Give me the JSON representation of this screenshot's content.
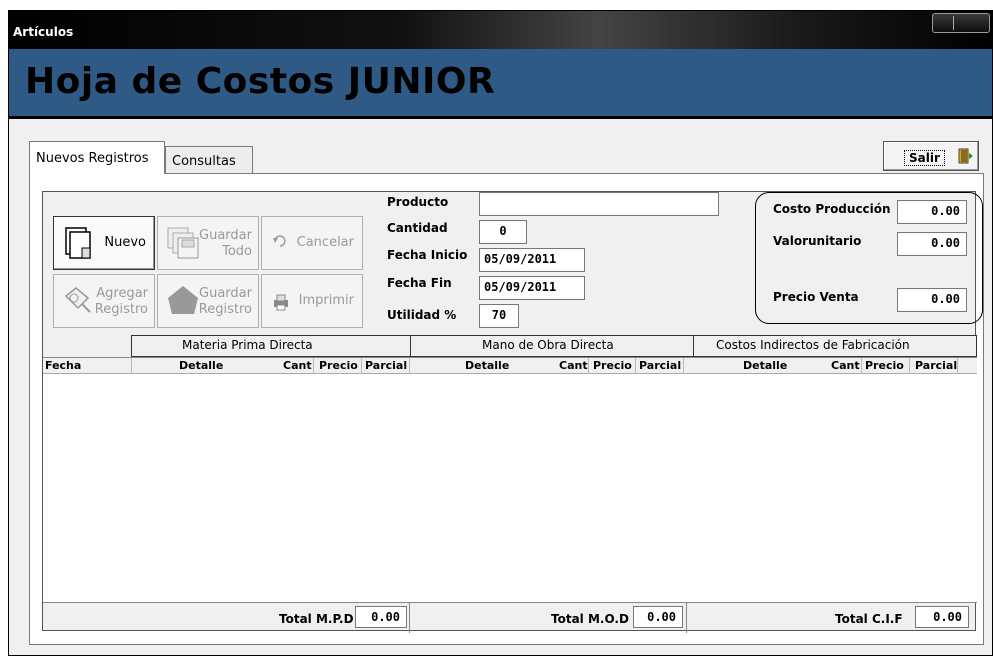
{
  "window": {
    "title": "Artículos"
  },
  "header": {
    "title": "Hoja de Costos  JUNIOR"
  },
  "tabs": [
    {
      "label": "Nuevos Registros",
      "active": true
    },
    {
      "label": "Consultas",
      "active": false
    }
  ],
  "exit_button": {
    "label": "Salir",
    "icon": "exit-door-icon"
  },
  "toolbar": {
    "nuevo": {
      "label": "Nuevo",
      "enabled": true,
      "icon": "new-document-icon"
    },
    "guardar_todo": {
      "label_line1": "Guardar",
      "label_line2": "Todo",
      "enabled": false,
      "icon": "save-all-icon"
    },
    "cancelar": {
      "label": "Cancelar",
      "enabled": false,
      "icon": "undo-icon"
    },
    "agregar_registro": {
      "label_line1": "Agregar",
      "label_line2": "Registro",
      "enabled": false,
      "icon": "add-record-icon"
    },
    "guardar_registro": {
      "label_line1": "Guardar",
      "label_line2": "Registro",
      "enabled": false,
      "icon": "save-record-icon"
    },
    "imprimir": {
      "label": "Imprimir",
      "enabled": false,
      "icon": "printer-icon"
    }
  },
  "form": {
    "producto_label": "Producto",
    "producto_value": "",
    "cantidad_label": "Cantidad",
    "cantidad_value": "0",
    "fecha_inicio_label": "Fecha Inicio",
    "fecha_inicio_value": "05/09/2011",
    "fecha_fin_label": "Fecha Fin",
    "fecha_fin_value": "05/09/2011",
    "utilidad_label": "Utilidad %",
    "utilidad_value": "70"
  },
  "costs": {
    "costo_produccion_label": "Costo Producción",
    "costo_produccion_value": "0.00",
    "valor_unitario_label": "Valorunitario",
    "valor_unitario_value": "0.00",
    "precio_venta_label": "Precio Venta",
    "precio_venta_value": "0.00"
  },
  "grid": {
    "groups": [
      "Materia Prima Directa",
      "Mano de Obra Directa",
      "Costos Indirectos de Fabricación"
    ],
    "columns": {
      "fecha": "Fecha",
      "mpd": [
        "Detalle",
        "Cant",
        "Precio",
        "Parcial"
      ],
      "mod": [
        "Detalle",
        "Cant",
        "Precio",
        "Parcial"
      ],
      "cif": [
        "Detalle",
        "Cant",
        "Precio",
        "Parcial"
      ]
    },
    "rows": []
  },
  "totals": {
    "mpd_label": "Total M.P.D",
    "mpd_value": "0.00",
    "mod_label": "Total M.O.D",
    "mod_value": "0.00",
    "cif_label": "Total C.I.F",
    "cif_value": "0.00"
  }
}
